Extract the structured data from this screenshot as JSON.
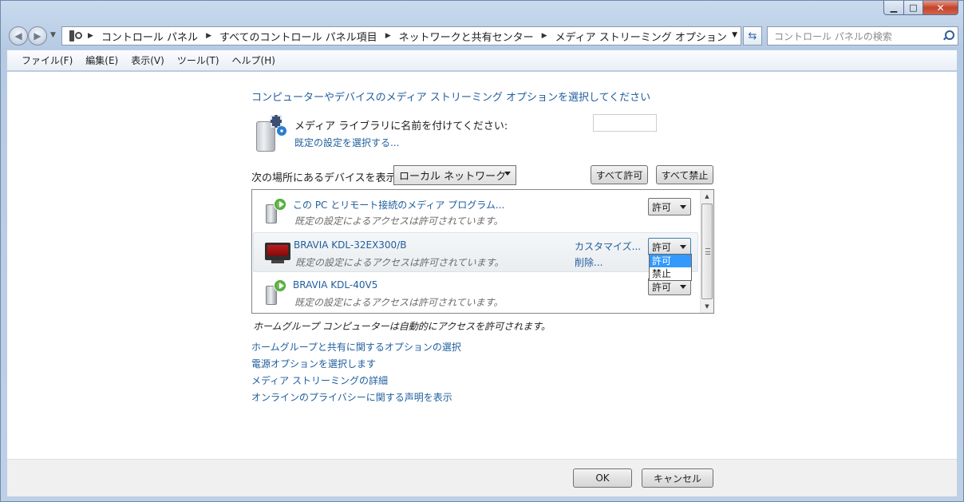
{
  "window": {
    "minimize": "▁",
    "maximize": "□",
    "close": "✕"
  },
  "nav": {
    "back": "◀",
    "forward": "▶",
    "breadcrumbs": [
      "コントロール パネル",
      "すべてのコントロール パネル項目",
      "ネットワークと共有センター",
      "メディア ストリーミング オプション"
    ],
    "search_placeholder": "コントロール パネルの検索",
    "refresh": "⇆"
  },
  "menubar": {
    "items": [
      "ファイル(F)",
      "編集(E)",
      "表示(V)",
      "ツール(T)",
      "ヘルプ(H)"
    ]
  },
  "main": {
    "title": "コンピューターやデバイスのメディア ストリーミング オプションを選択してください",
    "library_label": "メディア ライブラリに名前を付けてください:",
    "library_name_value": "",
    "default_settings_link": "既定の設定を選択する...",
    "show_devices_label": "次の場所にあるデバイスを表示:",
    "network_select_value": "ローカル ネットワーク",
    "allow_all": "すべて許可",
    "deny_all": "すべて禁止",
    "devices": [
      {
        "name": "この PC とリモート接続のメディア プログラム...",
        "status": "既定の設定によるアクセスは許可されています。",
        "permission": "許可",
        "icon": "pc-media-icon"
      },
      {
        "name": "BRAVIA KDL-32EX300/B",
        "status": "既定の設定によるアクセスは許可されています。",
        "permission": "許可",
        "customize": "カスタマイズ...",
        "delete": "削除...",
        "icon": "tv-icon"
      },
      {
        "name": "BRAVIA KDL-40V5",
        "status": "既定の設定によるアクセスは許可されています。",
        "permission": "許可",
        "icon": "pc-media-icon"
      }
    ],
    "dropdown_options": [
      "許可",
      "禁止"
    ],
    "homegroup_note": "ホームグループ コンピューターは自動的にアクセスを許可されます。",
    "links": [
      "ホームグループと共有に関するオプションの選択",
      "電源オプションを選択します",
      "メディア ストリーミングの詳細",
      "オンラインのプライバシーに関する声明を表示"
    ]
  },
  "footer": {
    "ok": "OK",
    "cancel": "キャンセル"
  },
  "colors": {
    "link": "#1f5e9c",
    "selection": "#3399ff"
  }
}
